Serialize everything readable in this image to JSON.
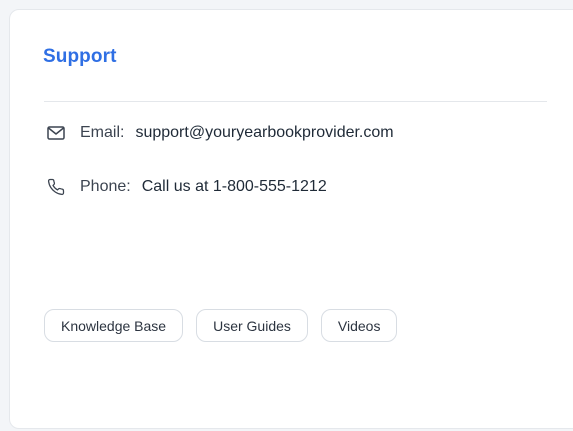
{
  "card": {
    "title": "Support",
    "email": {
      "icon": "envelope-icon",
      "label": "Email:",
      "value": "support@youryearbookprovider.com"
    },
    "phone": {
      "icon": "phone-icon",
      "label": "Phone:",
      "value": "Call us at 1-800-555-1212"
    },
    "links": [
      {
        "label": "Knowledge Base"
      },
      {
        "label": "User Guides"
      },
      {
        "label": "Videos"
      }
    ]
  },
  "colors": {
    "accent": "#2f6fe4",
    "text": "#1f2a37",
    "muted": "#3c4450",
    "border": "#d8dde3"
  }
}
